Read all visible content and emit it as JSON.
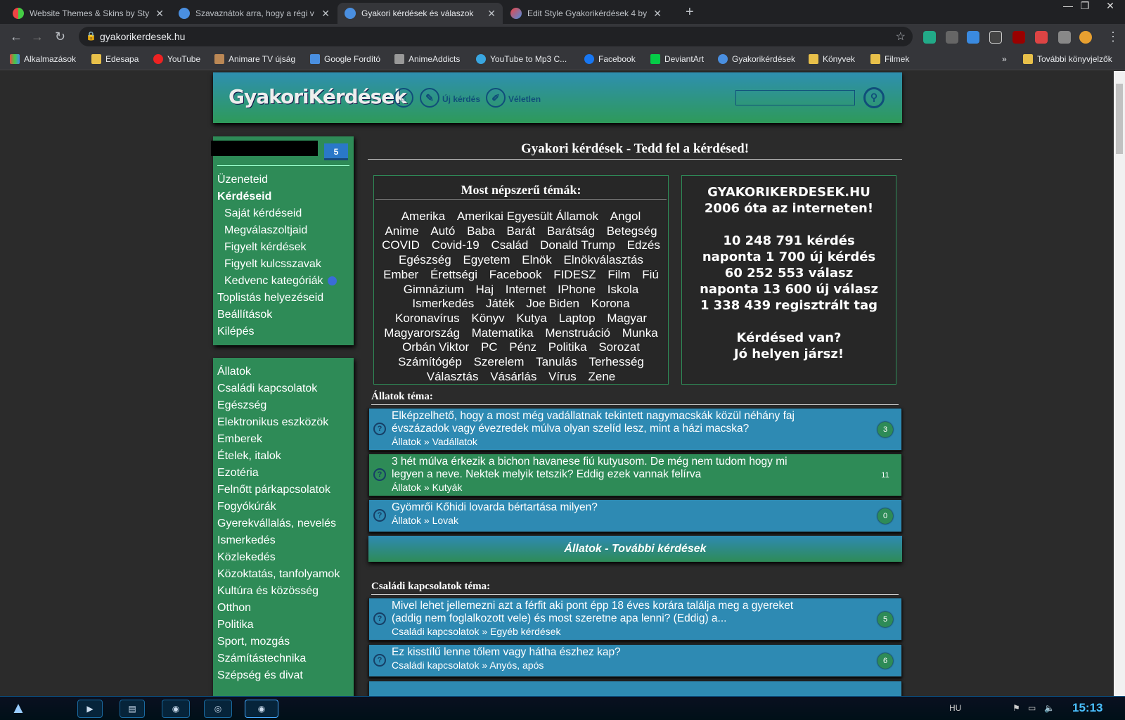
{
  "browser": {
    "tabs": [
      {
        "title": "Website Themes &amp; Skins by Styl",
        "color": "#e44"
      },
      {
        "title": "Szavaznátok arra, hogy a régi v",
        "color": "#4a8fe0"
      },
      {
        "title": "Gyakori kérdések és válaszok",
        "color": "#4a8fe0"
      },
      {
        "title": "Edit Style Gyakorikérdések 4 by",
        "color": "#4a8fe0"
      }
    ],
    "url": "gyakorikerdesek.hu",
    "bookmarks": [
      "Alkalmazások",
      "Edesapa",
      "YouTube",
      "Animare TV újság",
      "Google Fordító",
      "AnimeAddicts",
      "YouTube to Mp3 C...",
      "Facebook",
      "DeviantArt",
      "Gyakorikérdések",
      "Könyvek",
      "Filmek"
    ],
    "other_bookmarks": "További könyvjelzők"
  },
  "header": {
    "logo": "GyakoriKérdések",
    "new_question": "Új kérdés",
    "random": "Véletlen"
  },
  "user": {
    "badge": "5",
    "menu": [
      {
        "label": "Üzeneteid",
        "type": "top"
      },
      {
        "label": "Kérdéseid",
        "type": "bold"
      },
      {
        "label": "Saját kérdéseid",
        "type": "sub"
      },
      {
        "label": "Megválaszoltjaid",
        "type": "sub"
      },
      {
        "label": "Figyelt kérdések",
        "type": "sub"
      },
      {
        "label": "Figyelt kulcsszavak",
        "type": "sub"
      },
      {
        "label": "Kedvenc kategóriák",
        "type": "sub"
      },
      {
        "label": "Toplistás helyezéseid",
        "type": "top"
      },
      {
        "label": "Beállítások",
        "type": "top"
      },
      {
        "label": "Kilépés",
        "type": "top"
      }
    ]
  },
  "categories": [
    "Állatok",
    "Családi kapcsolatok",
    "Egészség",
    "Elektronikus eszközök",
    "Emberek",
    "Ételek, italok",
    "Ezotéria",
    "Felnőtt párkapcsolatok",
    "Fogyókúrák",
    "Gyerekvállalás, nevelés",
    "Ismerkedés",
    "Közlekedés",
    "Közoktatás, tanfolyamok",
    "Kultúra és közösség",
    "Otthon",
    "Politika",
    "Sport, mozgás",
    "Számítástechnika",
    "Szépség és divat"
  ],
  "main": {
    "title": "Gyakori kérdések - Tedd fel a kérdésed!",
    "popular_title": "Most népszerű témák:",
    "popular": [
      "Amerika",
      "Amerikai Egyesült Államok",
      "Angol",
      "Anime",
      "Autó",
      "Baba",
      "Barát",
      "Barátság",
      "Betegség",
      "COVID",
      "Covid-19",
      "Család",
      "Donald Trump",
      "Edzés",
      "Egészség",
      "Egyetem",
      "Elnök",
      "Elnökválasztás",
      "Ember",
      "Érettségi",
      "Facebook",
      "FIDESZ",
      "Film",
      "Fiú",
      "Gimnázium",
      "Haj",
      "Internet",
      "IPhone",
      "Iskola",
      "Ismerkedés",
      "Játék",
      "Joe Biden",
      "Korona",
      "Koronavírus",
      "Könyv",
      "Kutya",
      "Laptop",
      "Magyar",
      "Magyarország",
      "Matematika",
      "Menstruáció",
      "Munka",
      "Orbán Viktor",
      "PC",
      "Pénz",
      "Politika",
      "Sorozat",
      "Számítógép",
      "Szerelem",
      "Tanulás",
      "Terhesség",
      "Választás",
      "Vásárlás",
      "Vírus",
      "Zene"
    ],
    "stats": [
      "GYAKORIKERDESEK.HU",
      "2006 óta az interneten!",
      "",
      "10 248 791 kérdés",
      "naponta 1 700 új kérdés",
      "60 252 553 válasz",
      "naponta 13 600 új válasz",
      "1 338 439 regisztrált tag",
      "",
      "Kérdésed van?",
      "Jó helyen jársz!"
    ],
    "sections": [
      {
        "title": "Állatok téma:",
        "more": "Állatok - További kérdések",
        "questions": [
          {
            "text": "Elképzelhető, hogy a most még vadállatnak tekintett nagymacskák közül néhány faj évszázadok vagy évezredek múlva olyan szelíd lesz, mint a házi macska?",
            "cat": "Állatok » Vadállatok",
            "count": "3",
            "style": "blue"
          },
          {
            "text": "3 hét múlva érkezik a bichon havanese fiú kutyusom. De még nem tudom hogy mi legyen a neve. Nektek melyik tetszik? Eddig ezek vannak felírva",
            "cat": "Állatok » Kutyák",
            "count": "11",
            "style": "green"
          },
          {
            "text": "Gyömrői Kőhidi lovarda bértartása milyen?",
            "cat": "Állatok » Lovak",
            "count": "0",
            "style": "blue"
          }
        ]
      },
      {
        "title": "Családi kapcsolatok téma:",
        "questions": [
          {
            "text": "Mivel lehet jellemezni azt a férfit aki pont épp 18 éves korára találja meg a gyereket (addig nem foglalkozott vele) és most szeretne apa lenni? (Eddig) a...",
            "cat": "Családi kapcsolatok » Egyéb kérdések",
            "count": "5",
            "style": "blue"
          },
          {
            "text": "Ez kisstílű lenne tőlem vagy hátha észhez kap?",
            "cat": "Családi kapcsolatok » Anyós, após",
            "count": "6",
            "style": "blue"
          }
        ]
      }
    ]
  },
  "taskbar": {
    "time": "15:13",
    "lang": "HU"
  }
}
